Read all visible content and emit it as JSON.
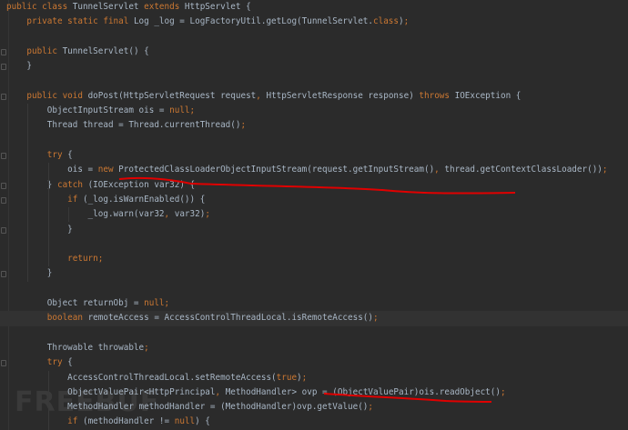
{
  "theme": {
    "background": "#2b2b2b",
    "keyword": "#cc7832",
    "text": "#a9b7c6",
    "current_line": "#323232",
    "annotation": "#e00000"
  },
  "watermark": "FREEBUF",
  "code": [
    [
      [
        "kw",
        "public class "
      ],
      [
        "pl",
        "TunnelServlet "
      ],
      [
        "kw",
        "extends "
      ],
      [
        "pl",
        "HttpServlet {"
      ]
    ],
    [
      [
        "pl",
        "    "
      ],
      [
        "kw",
        "private static final "
      ],
      [
        "pl",
        "Log _log = LogFactoryUtil.getLog(TunnelServlet."
      ],
      [
        "kw",
        "class"
      ],
      [
        "pl",
        ")"
      ],
      [
        "kw",
        ";"
      ]
    ],
    [],
    [
      [
        "pl",
        "    "
      ],
      [
        "kw",
        "public "
      ],
      [
        "pl",
        "TunnelServlet() {"
      ]
    ],
    [
      [
        "pl",
        "    }"
      ]
    ],
    [],
    [
      [
        "pl",
        "    "
      ],
      [
        "kw",
        "public void "
      ],
      [
        "pl",
        "doPost(HttpServletRequest request"
      ],
      [
        "kw",
        ", "
      ],
      [
        "pl",
        "HttpServletResponse response) "
      ],
      [
        "kw",
        "throws "
      ],
      [
        "pl",
        "IOException {"
      ]
    ],
    [
      [
        "pl",
        "        ObjectInputStream ois = "
      ],
      [
        "kw",
        "null;"
      ]
    ],
    [
      [
        "pl",
        "        Thread thread = Thread.currentThread()"
      ],
      [
        "kw",
        ";"
      ]
    ],
    [],
    [
      [
        "pl",
        "        "
      ],
      [
        "kw",
        "try "
      ],
      [
        "pl",
        "{"
      ]
    ],
    [
      [
        "pl",
        "            ois = "
      ],
      [
        "kw",
        "new "
      ],
      [
        "pl",
        "ProtectedClassLoaderObjectInputStream(request.getInputStream()"
      ],
      [
        "kw",
        ", "
      ],
      [
        "pl",
        "thread.getContextClassLoader())"
      ],
      [
        "kw",
        ";"
      ]
    ],
    [
      [
        "pl",
        "        } "
      ],
      [
        "kw",
        "catch "
      ],
      [
        "pl",
        "(IOException var32) {"
      ]
    ],
    [
      [
        "pl",
        "            "
      ],
      [
        "kw",
        "if "
      ],
      [
        "pl",
        "(_log.isWarnEnabled()) {"
      ]
    ],
    [
      [
        "pl",
        "                _log.warn(var32"
      ],
      [
        "kw",
        ", "
      ],
      [
        "pl",
        "var32)"
      ],
      [
        "kw",
        ";"
      ]
    ],
    [
      [
        "pl",
        "            }"
      ]
    ],
    [],
    [
      [
        "pl",
        "            "
      ],
      [
        "kw",
        "return;"
      ]
    ],
    [
      [
        "pl",
        "        }"
      ]
    ],
    [],
    [
      [
        "pl",
        "        Object returnObj = "
      ],
      [
        "kw",
        "null;"
      ]
    ],
    [
      [
        "pl",
        "        "
      ],
      [
        "kw",
        "boolean "
      ],
      [
        "pl",
        "remoteAccess = AccessControlThreadLocal.isRemoteAccess()"
      ],
      [
        "kw",
        ";"
      ]
    ],
    [],
    [
      [
        "pl",
        "        Throwable throwable"
      ],
      [
        "kw",
        ";"
      ]
    ],
    [
      [
        "pl",
        "        "
      ],
      [
        "kw",
        "try "
      ],
      [
        "pl",
        "{"
      ]
    ],
    [
      [
        "pl",
        "            AccessControlThreadLocal.setRemoteAccess("
      ],
      [
        "kw",
        "true"
      ],
      [
        "pl",
        ")"
      ],
      [
        "kw",
        ";"
      ]
    ],
    [
      [
        "pl",
        "            ObjectValuePair<HttpPrincipal"
      ],
      [
        "kw",
        ", "
      ],
      [
        "pl",
        "MethodHandler> ovp = (ObjectValuePair)ois.readObject()"
      ],
      [
        "kw",
        ";"
      ]
    ],
    [
      [
        "pl",
        "            MethodHandler methodHandler = (MethodHandler)ovp.getValue()"
      ],
      [
        "kw",
        ";"
      ]
    ],
    [
      [
        "pl",
        "            "
      ],
      [
        "kw",
        "if "
      ],
      [
        "pl",
        "(methodHandler != "
      ],
      [
        "kw",
        "null"
      ],
      [
        "pl",
        ") {"
      ]
    ]
  ]
}
